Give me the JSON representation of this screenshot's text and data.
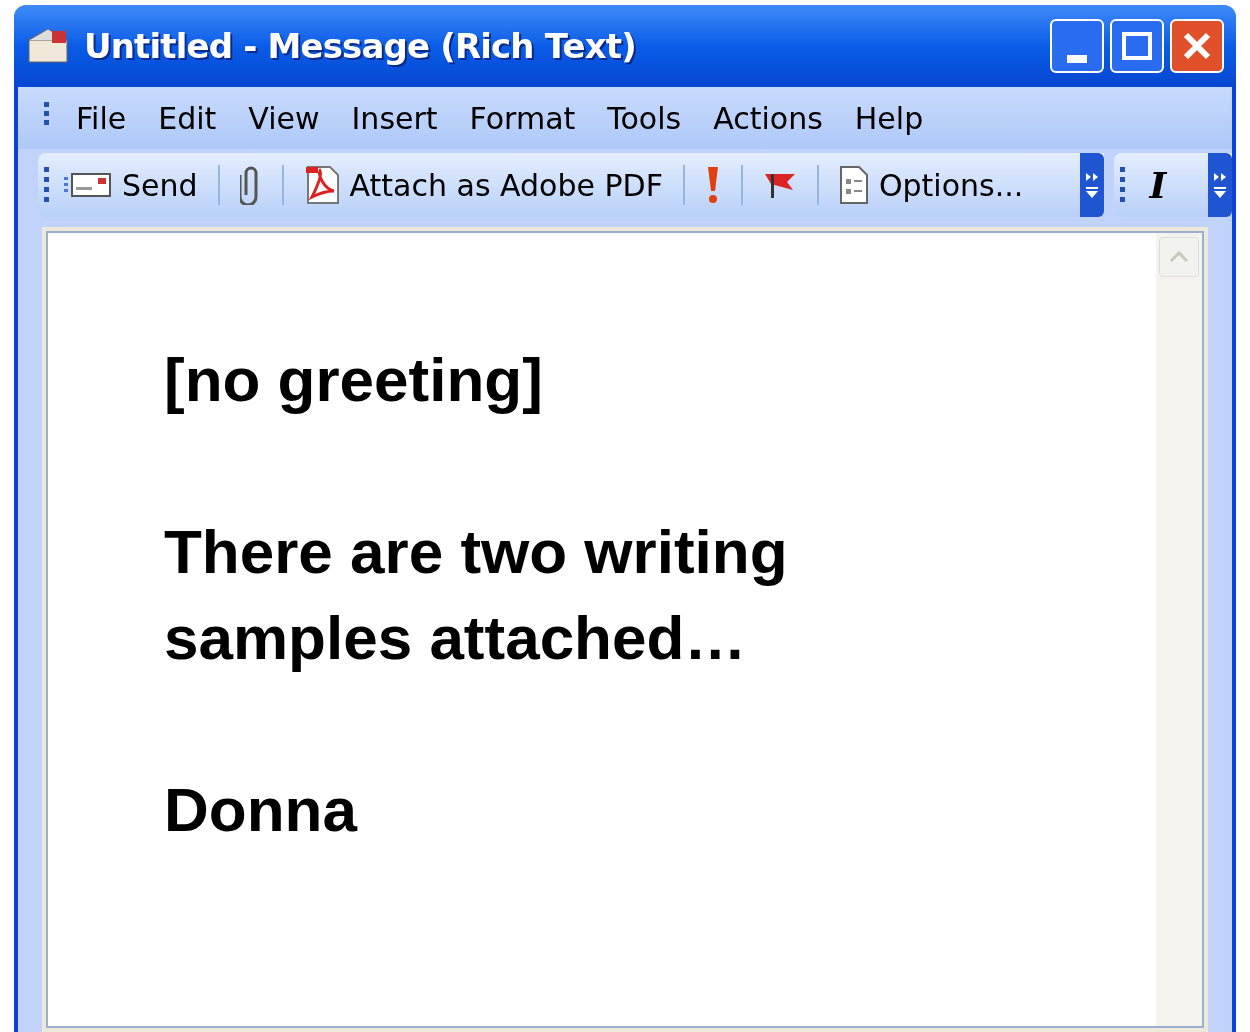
{
  "window": {
    "title": "Untitled - Message (Rich Text)"
  },
  "menu": [
    "File",
    "Edit",
    "View",
    "Insert",
    "Format",
    "Tools",
    "Actions",
    "Help"
  ],
  "toolbar": [
    {
      "kind": "send",
      "label": "Send"
    },
    {
      "kind": "attach"
    },
    {
      "kind": "pdf",
      "label": "Attach as Adobe PDF"
    },
    {
      "kind": "importance"
    },
    {
      "kind": "flag"
    },
    {
      "kind": "options",
      "label": "Options..."
    }
  ],
  "format_toolbar": {
    "italic": "I"
  },
  "body": {
    "paragraphs": [
      [
        "[no greeting]"
      ],
      [
        "There are two writing",
        "samples attached…"
      ],
      [
        "Donna"
      ]
    ]
  }
}
